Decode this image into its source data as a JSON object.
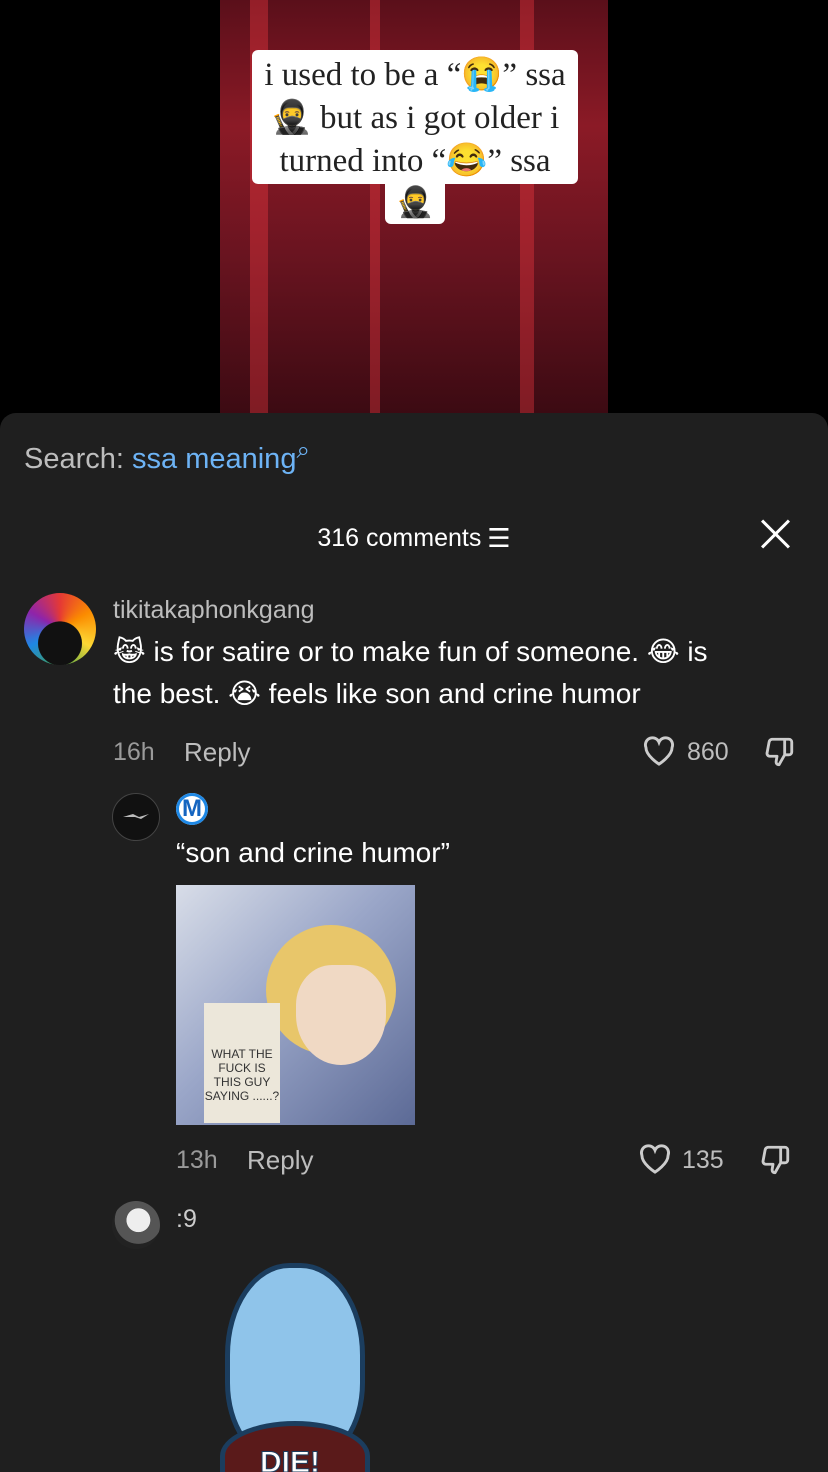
{
  "video": {
    "caption_line1": "i used to be a “😭” ssa",
    "caption_line2": "🥷 but as i got older i",
    "caption_line3": "turned into “😂” ssa",
    "caption_tail": "🥷"
  },
  "search": {
    "label": "Search:",
    "query": "ssa meaning",
    "icon": "search-icon"
  },
  "header": {
    "comments_count": "316 comments"
  },
  "comments": [
    {
      "username": "tikitakaphonkgang",
      "text_line1": "😹 is for satire or to make fun of someone. 😂 is",
      "text_line2": "the best. 😭 feels like son and crine humor",
      "time": "16h",
      "reply": "Reply",
      "likes": "860"
    },
    {
      "username": "M",
      "text": "“son and crine humor”",
      "image_text": "WHAT THE FUCK IS THIS GUY SAYING ......?",
      "time": "13h",
      "reply": "Reply",
      "likes": "135"
    },
    {
      "username": ":9",
      "sticker_text": "DIE!"
    }
  ]
}
